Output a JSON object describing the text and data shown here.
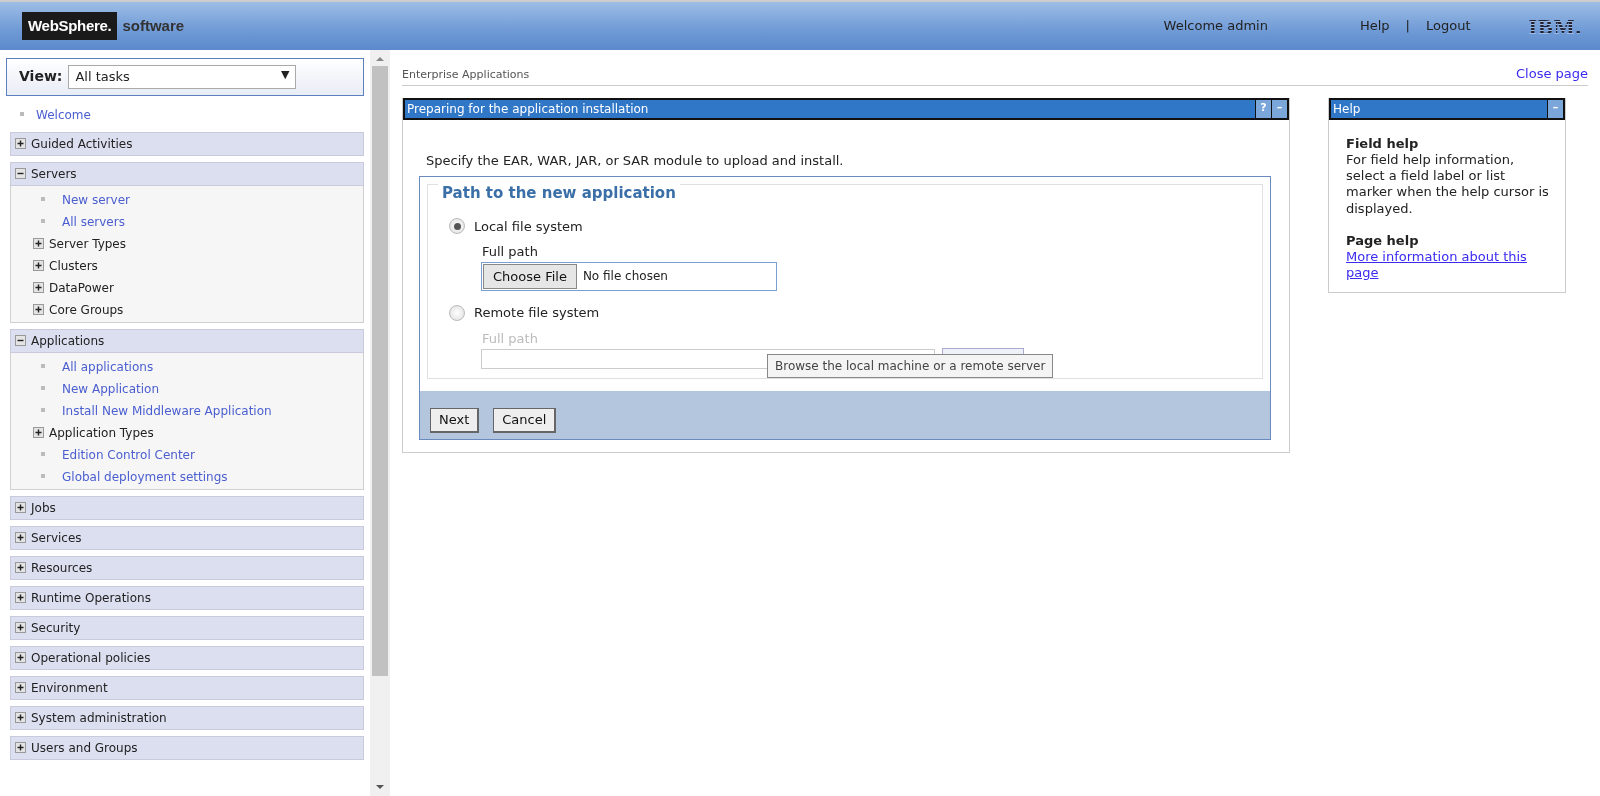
{
  "header": {
    "logo_brand": "WebSphere.",
    "logo_product": "software",
    "welcome": "Welcome admin",
    "links": [
      "Help",
      "Logout"
    ],
    "separator": "|",
    "vendor": "IBM."
  },
  "sidebar": {
    "view_label": "View:",
    "view_value": "All tasks",
    "view_caret": "▼",
    "items": [
      {
        "kind": "link",
        "label": "Welcome"
      },
      {
        "kind": "section",
        "label": "Guided Activities",
        "expanded": false
      },
      {
        "kind": "section",
        "label": "Servers",
        "expanded": true,
        "children": [
          {
            "kind": "link",
            "label": "New server"
          },
          {
            "kind": "link",
            "label": "All servers"
          },
          {
            "kind": "group",
            "label": "Server Types",
            "expanded": false
          },
          {
            "kind": "group",
            "label": "Clusters",
            "expanded": false
          },
          {
            "kind": "group",
            "label": "DataPower",
            "expanded": false
          },
          {
            "kind": "group",
            "label": "Core Groups",
            "expanded": false
          }
        ]
      },
      {
        "kind": "section",
        "label": "Applications",
        "expanded": true,
        "children": [
          {
            "kind": "link",
            "label": "All applications"
          },
          {
            "kind": "link",
            "label": "New Application"
          },
          {
            "kind": "link",
            "label": "Install New Middleware Application"
          },
          {
            "kind": "group",
            "label": "Application Types",
            "expanded": false
          },
          {
            "kind": "link",
            "label": "Edition Control Center"
          },
          {
            "kind": "link",
            "label": "Global deployment settings"
          }
        ]
      },
      {
        "kind": "section",
        "label": "Jobs",
        "expanded": false
      },
      {
        "kind": "section",
        "label": "Services",
        "expanded": false
      },
      {
        "kind": "section",
        "label": "Resources",
        "expanded": false
      },
      {
        "kind": "section",
        "label": "Runtime Operations",
        "expanded": false
      },
      {
        "kind": "section",
        "label": "Security",
        "expanded": false
      },
      {
        "kind": "section",
        "label": "Operational policies",
        "expanded": false
      },
      {
        "kind": "section",
        "label": "Environment",
        "expanded": false
      },
      {
        "kind": "section",
        "label": "System administration",
        "expanded": false
      },
      {
        "kind": "section",
        "label": "Users and Groups",
        "expanded": false
      }
    ]
  },
  "breadcrumb": "Enterprise Applications",
  "close_link": "Close page",
  "panel": {
    "title": "Preparing for the application installation",
    "help_glyph": "?",
    "minimize_glyph": "–",
    "intro": "Specify the EAR, WAR, JAR, or SAR module to upload and install.",
    "legend": "Path to the new application",
    "options": [
      {
        "label": "Local file system",
        "selected": true,
        "field_label": "Full path",
        "file_button": "Choose File",
        "file_status": "No file chosen"
      },
      {
        "label": "Remote file system",
        "selected": false,
        "field_label": "Full path"
      }
    ],
    "tooltip": "Browse the local machine or a remote server",
    "buttons": [
      "Next",
      "Cancel"
    ]
  },
  "help": {
    "title": "Help",
    "minimize_glyph": "–",
    "sections": [
      {
        "heading": "Field help",
        "text": "For field help information, select a field label or list marker when the help cursor is displayed."
      },
      {
        "heading": "Page help",
        "link": "More information about this page"
      }
    ]
  }
}
